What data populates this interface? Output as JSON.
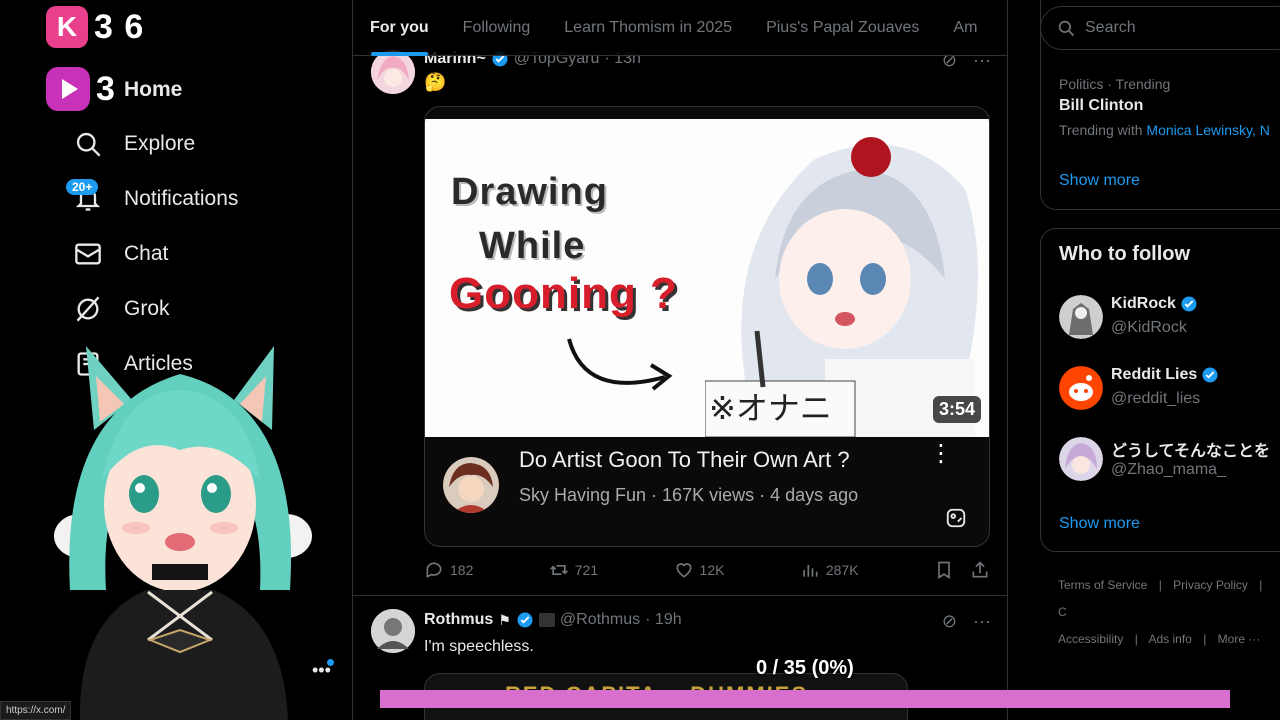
{
  "overlay": {
    "logo_letter": "K",
    "logo_text": "3 6",
    "home_prefix": "3",
    "progress_text": "0 / 35 (0%)",
    "progress_fraction": 0.0,
    "status_url": "https://x.com/"
  },
  "sidebar": {
    "items": [
      {
        "label": "Home",
        "icon": "home-icon"
      },
      {
        "label": "Explore",
        "icon": "search-icon"
      },
      {
        "label": "Notifications",
        "icon": "bell-icon",
        "badge": "20+"
      },
      {
        "label": "Chat",
        "icon": "mail-icon"
      },
      {
        "label": "Grok",
        "icon": "grok-icon"
      },
      {
        "label": "Articles",
        "icon": "articles-icon"
      }
    ],
    "more_label": "•••"
  },
  "tabs": [
    "For you",
    "Following",
    "Learn Thomism in 2025",
    "Pius's Papal Zouaves",
    "Am"
  ],
  "posts": [
    {
      "name": "Marinn~",
      "handle": "@TopGyaru",
      "time": "· 13h",
      "text": "🤔",
      "video": {
        "thumb_lines": [
          "Drawing",
          "While",
          "Gooning ?"
        ],
        "duration": "3:54",
        "title": "Do Artist Goon To Their Own Art ?",
        "meta": "Sky Having Fun · 167K views · 4 days ago"
      },
      "stats": {
        "replies": "182",
        "reposts": "721",
        "likes": "12K",
        "views": "287K"
      }
    },
    {
      "name": "Rothmus",
      "handle": "@Rothmus",
      "time": "· 19h",
      "text": "I'm speechless.",
      "media_text": "RED CAPITA... DUMMIES"
    }
  ],
  "right": {
    "search_placeholder": "Search",
    "trend": {
      "category": "Politics · Trending",
      "name": "Bill Clinton",
      "with_prefix": "Trending with",
      "with_link": "Monica Lewinsky, N",
      "show_more": "Show more"
    },
    "who_to_follow": {
      "title": "Who to follow",
      "accounts": [
        {
          "name": "KidRock",
          "handle": "@KidRock",
          "verified": true
        },
        {
          "name": "Reddit Lies",
          "handle": "@reddit_lies",
          "verified": true
        },
        {
          "name": "どうしてそんなことを",
          "handle": "@Zhao_mama_",
          "verified": false
        }
      ],
      "show_more": "Show more"
    },
    "footer": [
      "Terms of Service",
      "|",
      "Privacy Policy",
      "|",
      "C",
      "Accessibility",
      "|",
      "Ads info",
      "|",
      "More ···"
    ]
  },
  "colors": {
    "accent": "#1d9bf0",
    "bg": "#000000",
    "progress": "#d86fce",
    "logo_pink": "#e8408c"
  }
}
